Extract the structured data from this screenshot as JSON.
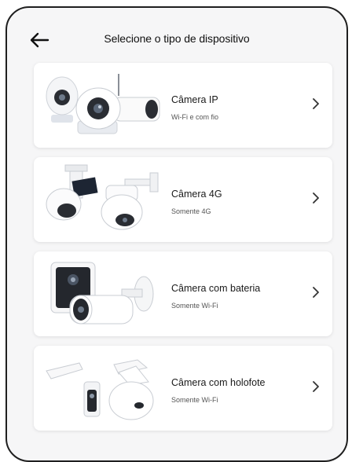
{
  "header": {
    "title": "Selecione o tipo de dispositivo",
    "back_icon": "arrow-left-icon"
  },
  "cards": [
    {
      "title": "Câmera IP",
      "subtitle": "Wi-Fi e com fio",
      "icon": "ip-camera-illustration"
    },
    {
      "title": "Câmera 4G",
      "subtitle": "Somente 4G",
      "icon": "4g-camera-illustration"
    },
    {
      "title": "Câmera com bateria",
      "subtitle": "Somente Wi-Fi",
      "icon": "battery-camera-illustration"
    },
    {
      "title": "Câmera com holofote",
      "subtitle": "Somente Wi-Fi",
      "icon": "floodlight-camera-illustration"
    }
  ],
  "colors": {
    "background": "#f6f6f7",
    "card": "#ffffff",
    "text": "#1a1a1a"
  }
}
